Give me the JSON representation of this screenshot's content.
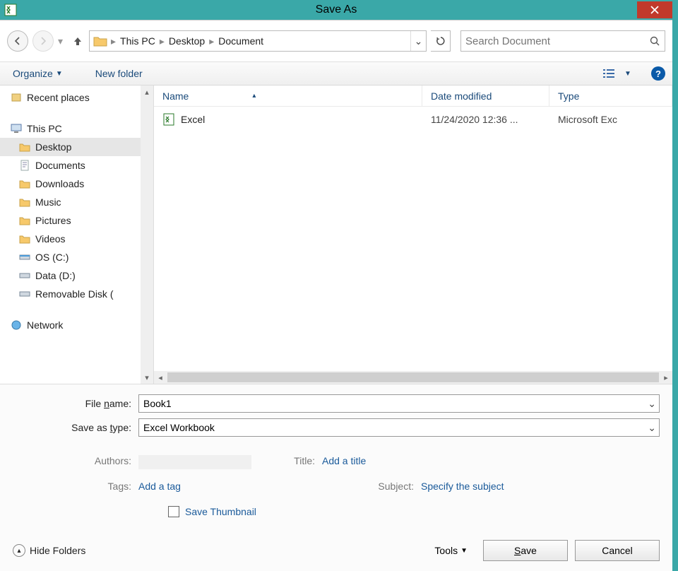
{
  "title": "Save As",
  "breadcrumbs": [
    "This PC",
    "Desktop",
    "Document"
  ],
  "search_placeholder": "Search Document",
  "toolbar": {
    "organize": "Organize",
    "new_folder": "New folder"
  },
  "tree": {
    "recent_places": "Recent places",
    "this_pc": "This PC",
    "items": [
      "Desktop",
      "Documents",
      "Downloads",
      "Music",
      "Pictures",
      "Videos",
      "OS (C:)",
      "Data (D:)",
      "Removable Disk ("
    ],
    "network": "Network"
  },
  "list": {
    "headers": {
      "name": "Name",
      "date": "Date modified",
      "type": "Type"
    },
    "rows": [
      {
        "name": "Excel",
        "date": "11/24/2020 12:36 ...",
        "type": "Microsoft Exc"
      }
    ]
  },
  "form": {
    "filename_label_pre": "File ",
    "filename_label_ul": "n",
    "filename_label_post": "ame:",
    "filename_value": "Book1",
    "type_label_pre": "Save as ",
    "type_label_ul": "t",
    "type_label_post": "ype:",
    "type_value": "Excel Workbook",
    "authors_label": "Authors:",
    "tags_label": "Tags:",
    "tags_value": "Add a tag",
    "title_label": "Title:",
    "title_value": "Add a title",
    "subject_label": "Subject:",
    "subject_value": "Specify the subject",
    "thumbnail_label": "Save Thumbnail"
  },
  "buttons": {
    "hide_folders": "Hide Folders",
    "tools": "Tools",
    "save_ul": "S",
    "save_post": "ave",
    "cancel": "Cancel"
  }
}
